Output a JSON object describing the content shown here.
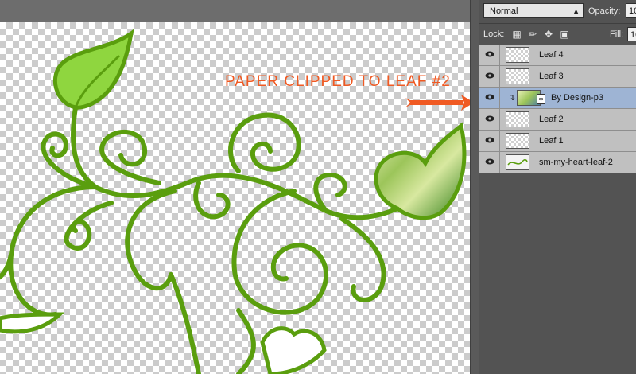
{
  "blend_mode": {
    "selected": "Normal"
  },
  "opacity": {
    "label": "Opacity:",
    "value": "10"
  },
  "lock": {
    "label": "Lock:"
  },
  "fill": {
    "label": "Fill:",
    "value": "10"
  },
  "layers": [
    {
      "name": "Leaf 4"
    },
    {
      "name": "Leaf 3"
    },
    {
      "name": "By Design-p3",
      "selected": true,
      "clipped": true
    },
    {
      "name": "Leaf 2",
      "underlined": true
    },
    {
      "name": "Leaf 1"
    },
    {
      "name": "sm-my-heart-leaf-2"
    }
  ],
  "annotation": {
    "text": "PAPER CLIPPED TO LEAF #2"
  },
  "colors": {
    "vine_green": "#5a9e0e",
    "leaf_green": "#8fd63f",
    "annotation_orange": "#f05a23",
    "selected_layer": "#9eb4d4"
  },
  "icons": [
    "eye-icon",
    "chain-link-icon",
    "lock-transparent-icon",
    "lock-brush-icon",
    "lock-move-icon",
    "lock-all-icon",
    "dropdown-arrow-icon",
    "clipping-arrow-icon"
  ]
}
